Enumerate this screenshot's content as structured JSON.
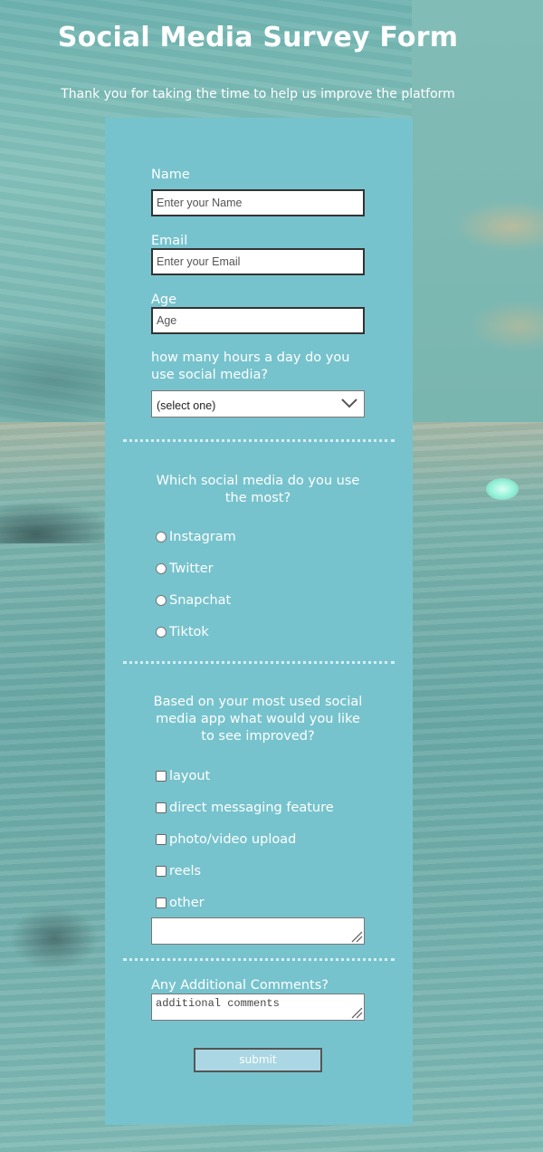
{
  "page": {
    "title": "Social Media Survey Form",
    "subtitle": "Thank you for taking the time to help us improve the platform"
  },
  "form": {
    "name": {
      "label": "Name",
      "placeholder": "Enter your Name"
    },
    "email": {
      "label": "Email",
      "placeholder": "Enter your Email"
    },
    "age": {
      "label": "Age",
      "placeholder": "Age"
    },
    "hours": {
      "label_line1": "how many hours a day do you",
      "label_line2": "use social media?",
      "selected": "(select one)",
      "icon": "chevron-down-icon"
    },
    "most_used": {
      "question_line1": "Which social media do you use",
      "question_line2": "the most?",
      "options": [
        "Instagram",
        "Twitter",
        "Snapchat",
        "Tiktok"
      ]
    },
    "improve": {
      "question_line1": "Based on your most used social",
      "question_line2": "media app what would you like",
      "question_line3": "to see improved?",
      "options": [
        "layout",
        "direct messaging feature",
        "photo/video upload",
        "reels",
        "other"
      ],
      "other_value": ""
    },
    "comments": {
      "label": "Any Additional Comments?",
      "placeholder": "additional comments"
    },
    "submit_label": "submit"
  },
  "colors": {
    "card": "#77c3cd",
    "submit_bg": "#aad7e3",
    "text": "#ffffff"
  }
}
